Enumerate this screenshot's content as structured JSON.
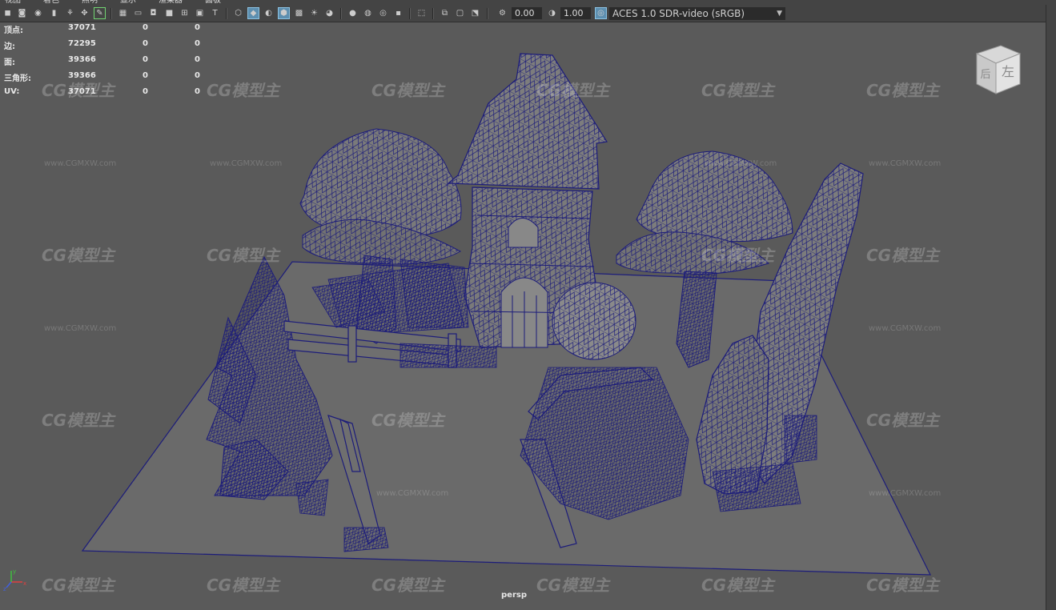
{
  "menubar": {
    "items": [
      "视图",
      "着色",
      "照明",
      "显示",
      "渲染器",
      "面板"
    ]
  },
  "toolbar": {
    "exposure_value": "0.00",
    "gamma_value": "1.00",
    "color_space": "ACES 1.0 SDR-video (sRGB)"
  },
  "hud": {
    "rows": [
      {
        "label": "顶点:",
        "total": "37071",
        "selected": "0",
        "tri": "0"
      },
      {
        "label": "边:",
        "total": "72295",
        "selected": "0",
        "tri": "0"
      },
      {
        "label": "面:",
        "total": "39366",
        "selected": "0",
        "tri": "0"
      },
      {
        "label": "三角形:",
        "total": "39366",
        "selected": "0",
        "tri": "0"
      },
      {
        "label": "UV:",
        "total": "37071",
        "selected": "0",
        "tri": "0"
      }
    ]
  },
  "viewcube": {
    "front_face": "后",
    "side_face": "左"
  },
  "viewport": {
    "camera": "persp"
  },
  "axis": {
    "x": "x",
    "y": "y",
    "z": "z"
  },
  "watermark": {
    "logo": "CG模型主",
    "url": "www.CGMXW.com"
  },
  "colors": {
    "wire": "#1c1c7a",
    "viewport_bg": "#5a5a5a",
    "ground": "#6a6a6a",
    "accent": "#5d8fb0"
  }
}
